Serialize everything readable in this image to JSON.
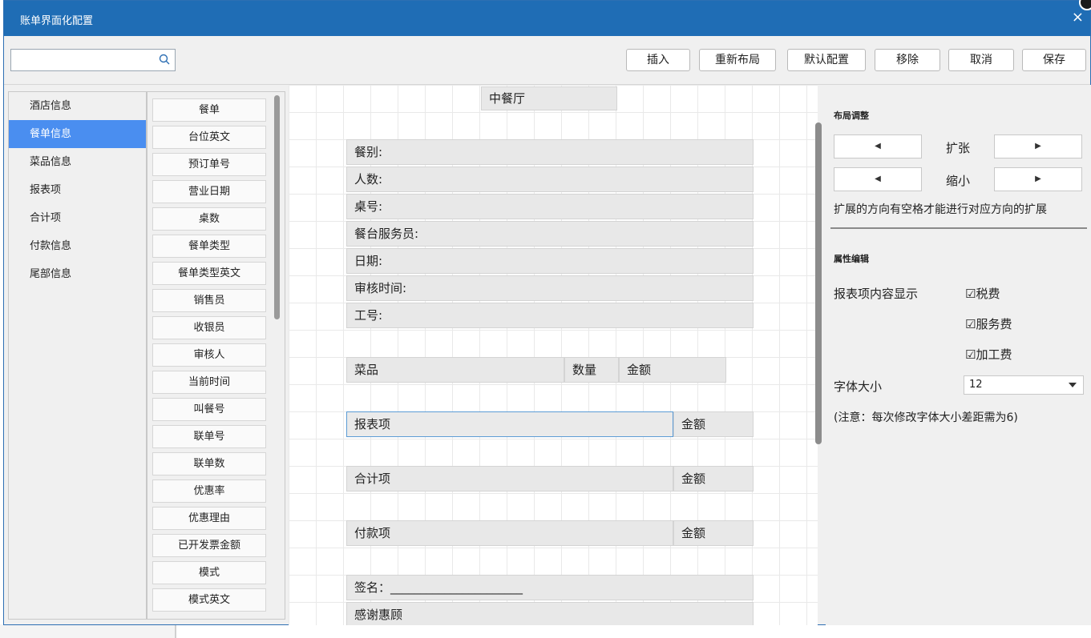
{
  "window": {
    "title": "账单界面化配置",
    "close": "×"
  },
  "search": {
    "value": "",
    "placeholder": ""
  },
  "toolbar": {
    "insert": "插入",
    "relayout": "重新布局",
    "default": "默认配置",
    "remove": "移除",
    "cancel": "取消",
    "save": "保存"
  },
  "categories": [
    "酒店信息",
    "餐单信息",
    "菜品信息",
    "报表项",
    "合计项",
    "付款信息",
    "尾部信息"
  ],
  "selected_category": "餐单信息",
  "fields": [
    "餐单",
    "台位英文",
    "预订单号",
    "营业日期",
    "桌数",
    "餐单类型",
    "餐单类型英文",
    "销售员",
    "收银员",
    "审核人",
    "当前时间",
    "叫餐号",
    "联单号",
    "联单数",
    "优惠率",
    "优惠理由",
    "已开发票金额",
    "模式",
    "模式英文"
  ],
  "canvas": {
    "header": "中餐厅",
    "info_rows": [
      "餐别:",
      "人数:",
      "桌号:",
      "餐台服务员:",
      "日期:",
      "审核时间:",
      "工号:"
    ],
    "dish": {
      "name": "菜品",
      "qty": "数量",
      "amount": "金额"
    },
    "report": {
      "name": "报表项",
      "amount": "金额"
    },
    "total": {
      "name": "合计项",
      "amount": "金额"
    },
    "payment": {
      "name": "付款项",
      "amount": "金额"
    },
    "signature": "签名：______________________",
    "thanks": "感谢惠顾"
  },
  "layout_panel": {
    "title": "布局调整",
    "expand": "扩张",
    "shrink": "缩小",
    "left_arrow": "◀",
    "right_arrow": "▶",
    "hint": "扩展的方向有空格才能进行对应方向的扩展"
  },
  "props_panel": {
    "title": "属性编辑",
    "report_display_label": "报表项内容显示",
    "checks": [
      "☑税费",
      "☑服务费",
      "☑加工费"
    ],
    "font_size_label": "字体大小",
    "font_size_value": "12",
    "note": "(注意：每次修改字体大小差距需为6)"
  }
}
